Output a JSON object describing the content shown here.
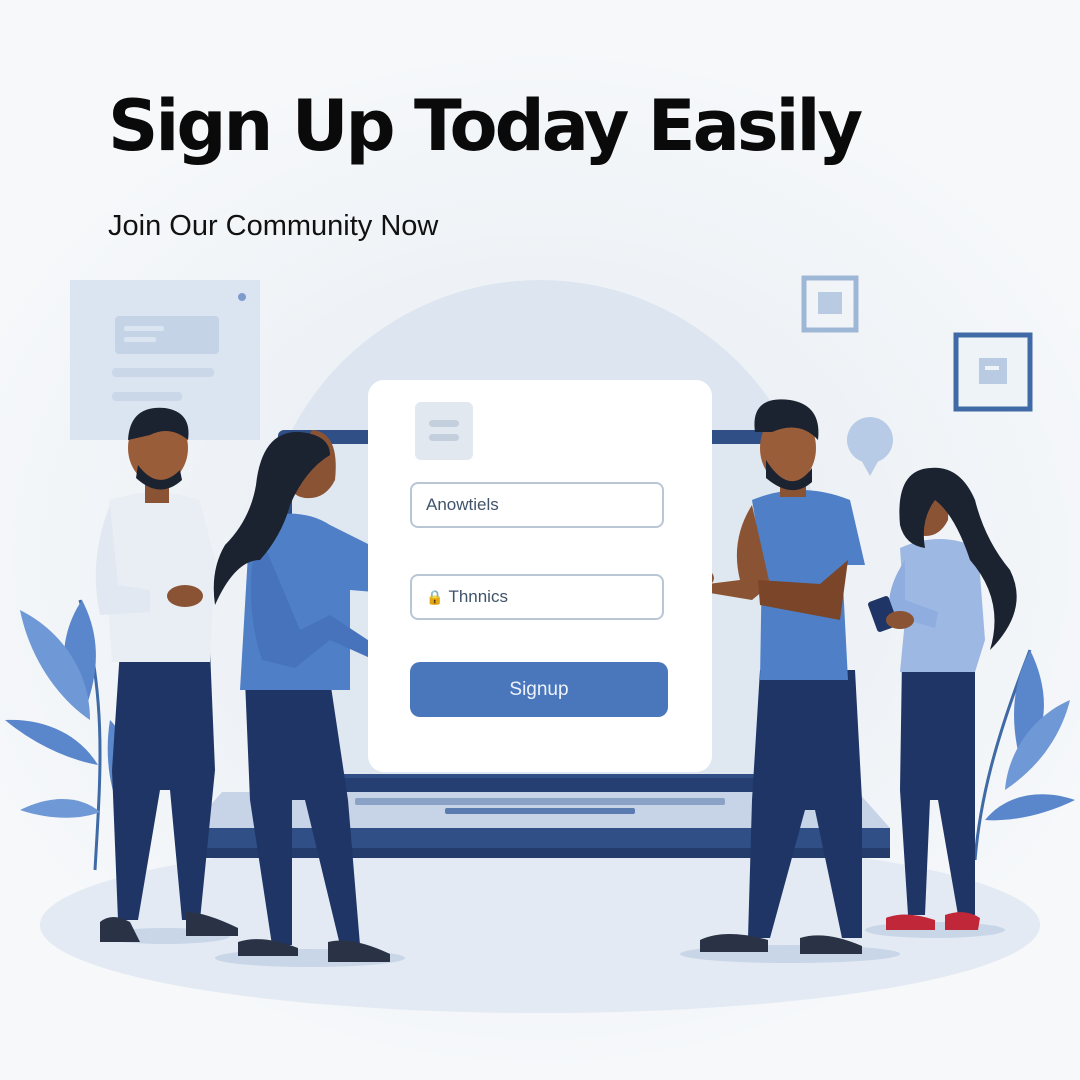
{
  "hero": {
    "headline": "Sign Up Today Easily",
    "subheadline": "Join Our Community Now"
  },
  "signup_form": {
    "field_1_value": "Anowtiels",
    "field_2_value": "Thnnics",
    "field_2_icon": "lock-icon",
    "submit_label": "Signup"
  },
  "colors": {
    "primary_blue": "#4a77bb",
    "navy": "#1f3565",
    "headline": "#0a0a0a",
    "leaf_blue": "#5a87cc"
  }
}
